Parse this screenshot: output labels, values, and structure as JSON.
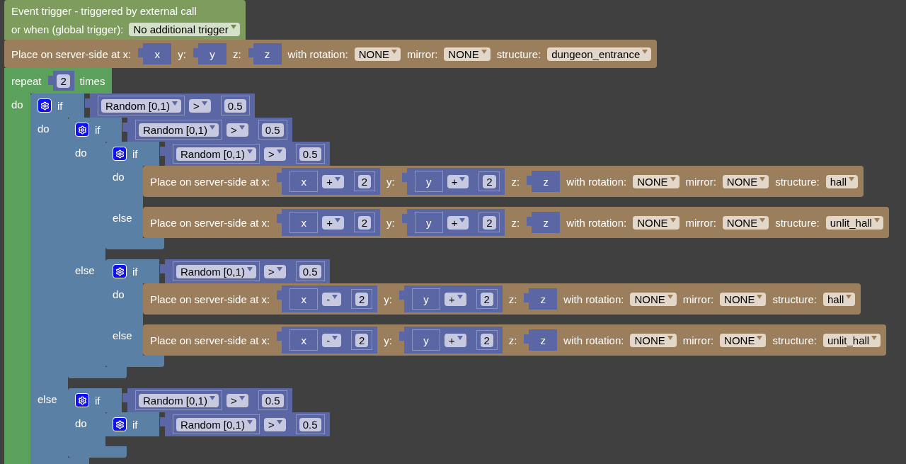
{
  "event": {
    "title": "Event trigger - triggered by external call",
    "trigger_label": "or when (global trigger):",
    "trigger": "No additional trigger"
  },
  "statements": [
    {
      "kind": "place",
      "label": "Place on server-side at x:",
      "x": {
        "kind": "var",
        "name": "x"
      },
      "y_label": "y:",
      "y": {
        "kind": "var",
        "name": "y"
      },
      "z_label": "z:",
      "z": {
        "kind": "var",
        "name": "z"
      },
      "rotation_label": "with rotation:",
      "rotation": "NONE",
      "mirror_label": "mirror:",
      "mirror": "NONE",
      "structure_label": "structure:",
      "structure": "dungeon_entrance"
    },
    {
      "kind": "repeat",
      "label": "repeat",
      "count": {
        "kind": "number",
        "value": "2"
      },
      "times_label": "times",
      "do_label": "do",
      "do": [
        {
          "kind": "if",
          "if_label": "if",
          "condition": {
            "kind": "compare",
            "left": {
              "kind": "random",
              "value": "Random [0,1)"
            },
            "op": ">",
            "right": {
              "kind": "number",
              "value": "0.5"
            }
          },
          "do_label": "do",
          "do": [
            {
              "kind": "if",
              "if_label": "if",
              "condition": {
                "kind": "compare",
                "left": {
                  "kind": "random",
                  "value": "Random [0,1)"
                },
                "op": ">",
                "right": {
                  "kind": "number",
                  "value": "0.5"
                }
              },
              "do_label": "do",
              "do": [
                {
                  "kind": "if",
                  "if_label": "if",
                  "condition": {
                    "kind": "compare",
                    "left": {
                      "kind": "random",
                      "value": "Random [0,1)"
                    },
                    "op": ">",
                    "right": {
                      "kind": "number",
                      "value": "0.5"
                    }
                  },
                  "do_label": "do",
                  "do": [
                    {
                      "kind": "place",
                      "label": "Place on server-side at x:",
                      "x": {
                        "kind": "math",
                        "left": {
                          "kind": "var",
                          "name": "x"
                        },
                        "op": "+",
                        "right": {
                          "kind": "number",
                          "value": "2"
                        }
                      },
                      "y_label": "y:",
                      "y": {
                        "kind": "math",
                        "left": {
                          "kind": "var",
                          "name": "y"
                        },
                        "op": "+",
                        "right": {
                          "kind": "number",
                          "value": "2"
                        }
                      },
                      "z_label": "z:",
                      "z": {
                        "kind": "var",
                        "name": "z"
                      },
                      "rotation_label": "with rotation:",
                      "rotation": "NONE",
                      "mirror_label": "mirror:",
                      "mirror": "NONE",
                      "structure_label": "structure:",
                      "structure": "hall"
                    }
                  ],
                  "else_label": "else",
                  "else": [
                    {
                      "kind": "place",
                      "label": "Place on server-side at x:",
                      "x": {
                        "kind": "math",
                        "left": {
                          "kind": "var",
                          "name": "x"
                        },
                        "op": "+",
                        "right": {
                          "kind": "number",
                          "value": "2"
                        }
                      },
                      "y_label": "y:",
                      "y": {
                        "kind": "math",
                        "left": {
                          "kind": "var",
                          "name": "y"
                        },
                        "op": "+",
                        "right": {
                          "kind": "number",
                          "value": "2"
                        }
                      },
                      "z_label": "z:",
                      "z": {
                        "kind": "var",
                        "name": "z"
                      },
                      "rotation_label": "with rotation:",
                      "rotation": "NONE",
                      "mirror_label": "mirror:",
                      "mirror": "NONE",
                      "structure_label": "structure:",
                      "structure": "unlit_hall"
                    }
                  ]
                }
              ],
              "else_label": "else",
              "else": [
                {
                  "kind": "if",
                  "if_label": "if",
                  "condition": {
                    "kind": "compare",
                    "left": {
                      "kind": "random",
                      "value": "Random [0,1)"
                    },
                    "op": ">",
                    "right": {
                      "kind": "number",
                      "value": "0.5"
                    }
                  },
                  "do_label": "do",
                  "do": [
                    {
                      "kind": "place",
                      "label": "Place on server-side at x:",
                      "x": {
                        "kind": "math",
                        "left": {
                          "kind": "var",
                          "name": "x"
                        },
                        "op": "-",
                        "right": {
                          "kind": "number",
                          "value": "2"
                        }
                      },
                      "y_label": "y:",
                      "y": {
                        "kind": "math",
                        "left": {
                          "kind": "var",
                          "name": "y"
                        },
                        "op": "+",
                        "right": {
                          "kind": "number",
                          "value": "2"
                        }
                      },
                      "z_label": "z:",
                      "z": {
                        "kind": "var",
                        "name": "z"
                      },
                      "rotation_label": "with rotation:",
                      "rotation": "NONE",
                      "mirror_label": "mirror:",
                      "mirror": "NONE",
                      "structure_label": "structure:",
                      "structure": "hall"
                    }
                  ],
                  "else_label": "else",
                  "else": [
                    {
                      "kind": "place",
                      "label": "Place on server-side at x:",
                      "x": {
                        "kind": "math",
                        "left": {
                          "kind": "var",
                          "name": "x"
                        },
                        "op": "-",
                        "right": {
                          "kind": "number",
                          "value": "2"
                        }
                      },
                      "y_label": "y:",
                      "y": {
                        "kind": "math",
                        "left": {
                          "kind": "var",
                          "name": "y"
                        },
                        "op": "+",
                        "right": {
                          "kind": "number",
                          "value": "2"
                        }
                      },
                      "z_label": "z:",
                      "z": {
                        "kind": "var",
                        "name": "z"
                      },
                      "rotation_label": "with rotation:",
                      "rotation": "NONE",
                      "mirror_label": "mirror:",
                      "mirror": "NONE",
                      "structure_label": "structure:",
                      "structure": "unlit_hall"
                    }
                  ]
                }
              ]
            }
          ],
          "else_label": "else",
          "else": [
            {
              "kind": "if",
              "if_label": "if",
              "condition": {
                "kind": "compare",
                "left": {
                  "kind": "random",
                  "value": "Random [0,1)"
                },
                "op": ">",
                "right": {
                  "kind": "number",
                  "value": "0.5"
                }
              },
              "do_label": "do",
              "do": [
                {
                  "kind": "if",
                  "if_label": "if",
                  "condition": {
                    "kind": "compare",
                    "left": {
                      "kind": "random",
                      "value": "Random [0,1)"
                    },
                    "op": ">",
                    "right": {
                      "kind": "number",
                      "value": "0.5"
                    }
                  }
                }
              ]
            }
          ]
        }
      ]
    }
  ]
}
